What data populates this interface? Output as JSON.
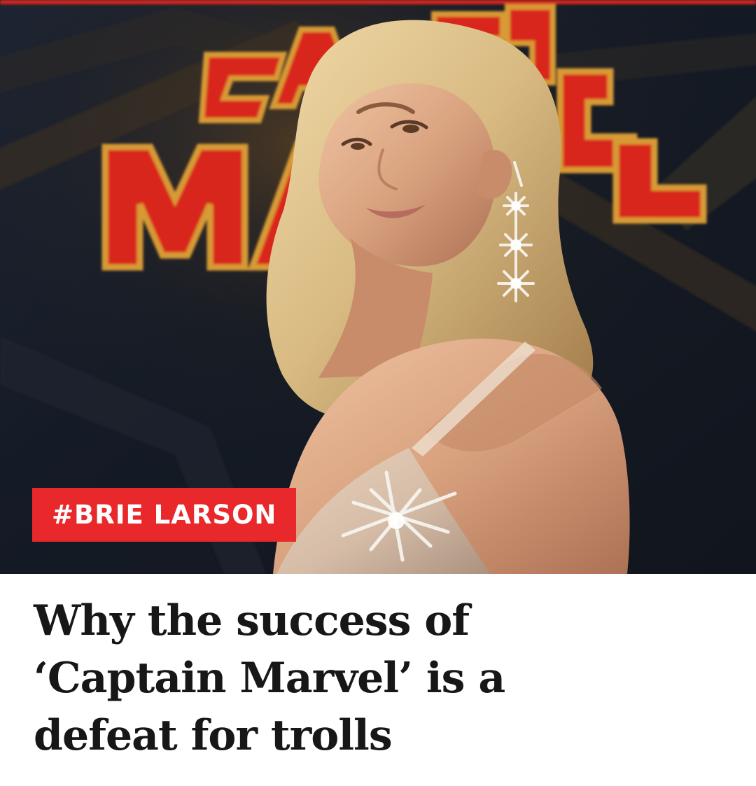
{
  "photo": {
    "background_logo_text": "CAPTAIN MARVEL",
    "colors": {
      "background": "#151b26",
      "logo_red": "#d9261f",
      "logo_gold": "#d79a35",
      "hair": "#d7bb83",
      "skin": "#d9a27f"
    }
  },
  "tag": {
    "text": "#BRIE LARSON",
    "color": "#e8282b"
  },
  "headline": {
    "line_1": "Why the success of",
    "line_2": "‘Captain Marvel’ is a",
    "line_3": "defeat for trolls"
  }
}
